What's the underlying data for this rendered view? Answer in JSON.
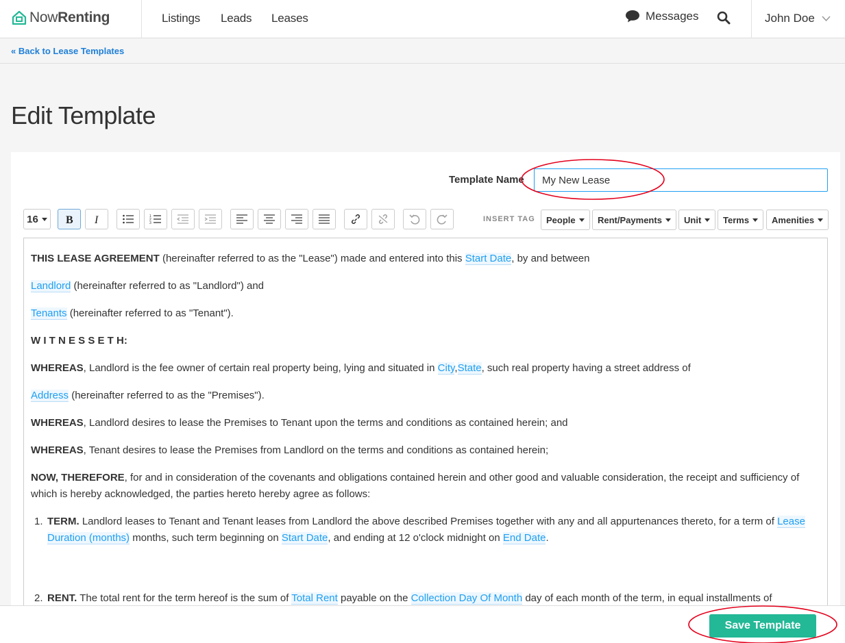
{
  "brand": {
    "name_part1": "Now",
    "name_part2": "Renting",
    "accent": "#23b896",
    "link": "#1e9ff2"
  },
  "nav": {
    "listings": "Listings",
    "leads": "Leads",
    "leases": "Leases",
    "messages": "Messages",
    "user": "John Doe"
  },
  "breadcrumb": "« Back to Lease Templates",
  "page_title": "Edit Template",
  "form": {
    "template_name_label": "Template Name",
    "template_name_value": "My New Lease"
  },
  "toolbar": {
    "font_size": "16",
    "insert_tag_label": "INSERT TAG",
    "dropdowns": [
      "People",
      "Rent/Payments",
      "Unit",
      "Terms",
      "Amenities"
    ]
  },
  "doc": {
    "p1_bold": "THIS LEASE AGREEMENT",
    "p1_text": " (hereinafter referred to as the \"Lease\") made and entered into this ",
    "p1_tag": "Start Date",
    "p1_end": ", by and between",
    "p2_tag": "Landlord",
    "p2_text": " (hereinafter referred to as \"Landlord\") and",
    "p3_tag": "Tenants",
    "p3_text": " (hereinafter referred to as \"Tenant\").",
    "witnesseth": "W I T N E S S E T H:",
    "whereas": "WHEREAS",
    "p5_text": ", Landlord is the fee owner of certain real property being, lying and situated in ",
    "p5_tag_city": "City",
    "p5_comma": ",",
    "p5_tag_state": "State",
    "p5_end": ", such real property having a street address of",
    "p6_tag": "Address",
    "p6_text": " (hereinafter referred to as the \"Premises\").",
    "p7_text": ", Landlord desires to lease the Premises to Tenant upon the terms and conditions as contained herein; and",
    "p8_text": ", Tenant desires to lease the Premises from Landlord on the terms and conditions as contained herein;",
    "p9_bold": "NOW, THEREFORE",
    "p9_text": ", for and in consideration of the covenants and obligations contained herein and other good and valuable consideration, the receipt and sufficiency of which is hereby acknowledged, the parties hereto hereby agree as follows:",
    "li1_num": "1.",
    "li1_bold": "TERM.",
    "li1_text": " Landlord leases to Tenant and Tenant leases from Landlord the above described Premises together with any and all appurtenances thereto, for a term of ",
    "li1_tag1": "Lease Duration (months)",
    "li1_text2": " months, such term beginning on ",
    "li1_tag2": "Start Date",
    "li1_text3": ", and ending at 12 o'clock midnight on ",
    "li1_tag3": "End Date",
    "li1_end": ".",
    "li2_num": "2.",
    "li2_bold": "RENT.",
    "li2_text": " The total rent for the term hereof is the sum of ",
    "li2_tag1": "Total Rent",
    "li2_text2": " payable on the ",
    "li2_tag2": "Collection Day Of Month",
    "li2_text3": " day of each month of the term, in equal installments of"
  },
  "save_button": "Save Template",
  "annotation_color": "#e3001b"
}
